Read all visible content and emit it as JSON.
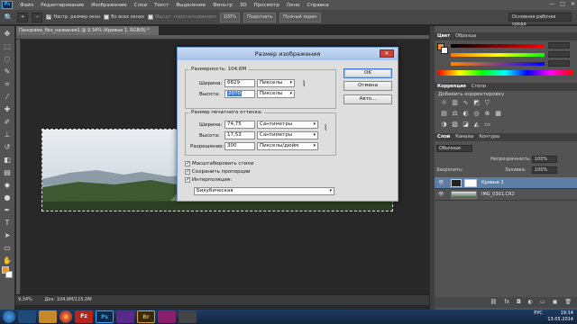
{
  "app": {
    "logo": "Ps"
  },
  "menu": [
    "Файл",
    "Редактирование",
    "Изображение",
    "Слои",
    "Текст",
    "Выделение",
    "Фильтр",
    "3D",
    "Просмотр",
    "Окно",
    "Справка"
  ],
  "window_controls": {
    "minimize": "—",
    "maximize": "□",
    "close": "✕"
  },
  "options_bar": {
    "resize_windows": "Настр. размер окон",
    "all_windows": "Во всех окнах",
    "scrubby_zoom": "Масшт. перетаскиванием",
    "zoom_100": "100%",
    "fit_screen": "Подогнать",
    "fill_screen": "Полный экран",
    "workspace": "Основная рабочая среда"
  },
  "document": {
    "tab_title": "Панорама_без_названия1 @ 9,34% (Кривые 1, RGB/8) *",
    "zoom": "9,34%",
    "doc_size": "Док: 104,6M/115,0M"
  },
  "colors": {
    "foreground": "#f7921e",
    "background": "#ffffff",
    "accent": "#3d7bd6"
  },
  "dialog": {
    "title": "Размер изображения",
    "pixel_dims_label": "Размерность:",
    "pixel_dims_value": "104,6M",
    "width_label": "Ширина:",
    "width_value": "6829",
    "width_unit": "Пикселы",
    "height_label": "Высота:",
    "height_value": "2070",
    "height_unit": "Пикселы",
    "doc_size_label": "Размер печатного оттиска:",
    "doc_width_label": "Ширина:",
    "doc_width_value": "74,75",
    "doc_width_unit": "Сантиметры",
    "doc_height_label": "Высота:",
    "doc_height_value": "17,53",
    "doc_height_unit": "Сантиметры",
    "resolution_label": "Разрешение:",
    "resolution_value": "300",
    "resolution_unit": "Пикселы/дюйм",
    "scale_styles": "Масштабировать стили",
    "constrain": "Сохранить пропорции",
    "resample": "Интерполяция:",
    "resample_method": "Бикубическая",
    "ok": "OK",
    "cancel": "Отмена",
    "auto": "Авто...",
    "close": "✕",
    "chain": "⌇"
  },
  "panels": {
    "color_tabs": [
      "Цвет",
      "Образцы"
    ],
    "adjust_tabs": [
      "Коррекция",
      "Стили"
    ],
    "adjust_title": "Добавить корректировку",
    "layers_tabs": [
      "Слои",
      "Каналы",
      "Контуры"
    ],
    "kind": "Обычные",
    "opacity_label": "Непрозрачность:",
    "opacity_value": "100%",
    "lock_label": "Закрепить:",
    "fill_label": "Заливка:",
    "fill_value": "100%",
    "layers": [
      {
        "name": "Кривые 1",
        "active": true
      },
      {
        "name": "IMG_0301.CR2",
        "active": false
      }
    ]
  },
  "taskbar": {
    "apps": [
      "",
      "",
      "",
      "",
      "Fz",
      "Ps",
      "",
      "Br",
      "",
      ""
    ],
    "lang": "РУС",
    "time": "19:14",
    "date": "13.05.2014"
  }
}
